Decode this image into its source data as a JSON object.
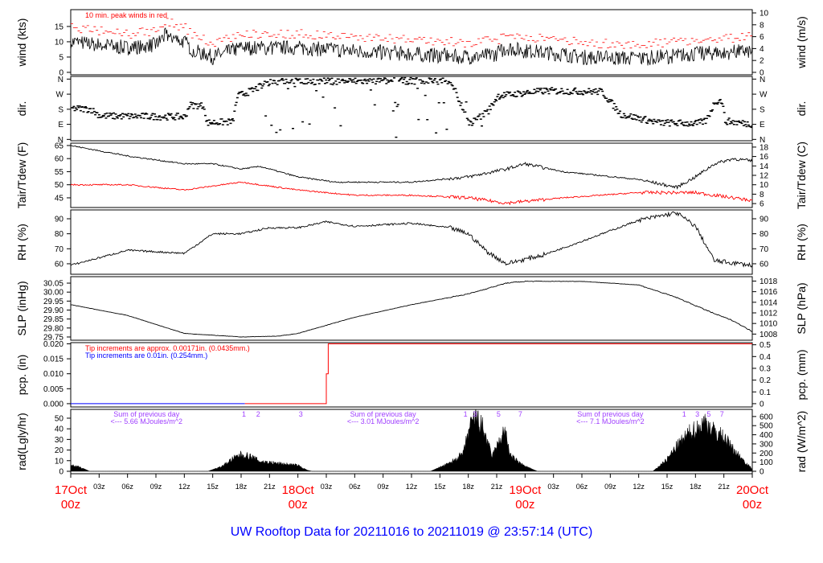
{
  "title": "UW Rooftop Data for 20211016  to  20211019 @ 23:57:14  (UTC)",
  "chart_data": {
    "type": "line",
    "x_unit": "hours since 17Oct 00z",
    "xlim": [
      0,
      72
    ],
    "x_ticks": [
      "03z",
      "06z",
      "09z",
      "12z",
      "15z",
      "18z",
      "21z"
    ],
    "day_labels": [
      {
        "hour": 0,
        "day": "17Oct",
        "time": "00z"
      },
      {
        "hour": 24,
        "day": "18Oct",
        "time": "00z"
      },
      {
        "hour": 48,
        "day": "19Oct",
        "time": "00z"
      },
      {
        "hour": 72,
        "day": "20Oct",
        "time": "00z"
      }
    ],
    "panels": [
      {
        "id": "wind",
        "ylabel": "wind (kts)",
        "ylabel_right": "wind (m/s)",
        "ylim": [
          -0.8,
          20.5
        ],
        "ticks": [
          0,
          5,
          10,
          15
        ],
        "right_ticks": [
          0,
          2,
          4,
          6,
          8,
          10
        ],
        "right_factor": 1.944,
        "annotation": "10 min. peak winds in red",
        "series": [
          {
            "name": "wind",
            "color": "#000000",
            "points": [
              [
                0,
                10
              ],
              [
                3,
                9
              ],
              [
                6,
                8
              ],
              [
                9,
                9
              ],
              [
                10,
                12
              ],
              [
                12,
                10
              ],
              [
                13,
                7
              ],
              [
                15,
                5
              ],
              [
                18,
                8
              ],
              [
                24,
                8
              ],
              [
                30,
                7
              ],
              [
                36,
                6
              ],
              [
                42,
                5
              ],
              [
                45,
                6
              ],
              [
                46,
                8
              ],
              [
                48,
                7
              ],
              [
                52,
                6
              ],
              [
                54,
                5
              ],
              [
                60,
                4.5
              ],
              [
                66,
                6
              ],
              [
                72,
                7
              ]
            ]
          }
        ],
        "peak_offset": 4
      },
      {
        "id": "dir",
        "ylabel": "dir.",
        "ylabel_right": "dir.",
        "ylim": [
          -8,
          376
        ],
        "tick_labels": [
          "N",
          "E",
          "S",
          "W",
          "N"
        ],
        "ticks": [
          0,
          90,
          180,
          270,
          360
        ],
        "series": [
          {
            "name": "direction",
            "color": "#000000",
            "points": [
              [
                0,
                185
              ],
              [
                2,
                180
              ],
              [
                3,
                140
              ],
              [
                12,
                135
              ],
              [
                12.4,
                205
              ],
              [
                14,
                200
              ],
              [
                14.2,
                100
              ],
              [
                17,
                105
              ],
              [
                17.5,
                260
              ],
              [
                19,
                290
              ],
              [
                21,
                345
              ],
              [
                40,
                350
              ],
              [
                42,
                90
              ],
              [
                44,
                170
              ],
              [
                45,
                260
              ],
              [
                50,
                290
              ],
              [
                56,
                285
              ],
              [
                58,
                150
              ],
              [
                62,
                100
              ],
              [
                66,
                95
              ],
              [
                67,
                110
              ],
              [
                68,
                230
              ],
              [
                68.7,
                230
              ],
              [
                69,
                110
              ],
              [
                72,
                90
              ]
            ]
          }
        ]
      },
      {
        "id": "temp",
        "ylabel": "Tair/Tdew (F)",
        "ylabel_right": "Tair/Tdew (C)",
        "ylim": [
          41.3,
          65.9
        ],
        "ticks": [
          45,
          50,
          55,
          60,
          65
        ],
        "right_ticks": [
          6,
          8,
          10,
          12,
          14,
          16,
          18
        ],
        "right_convert": "c2f",
        "series": [
          {
            "name": "Tair",
            "color": "#000000",
            "points": [
              [
                0,
                65
              ],
              [
                6,
                61
              ],
              [
                12,
                58
              ],
              [
                15,
                58
              ],
              [
                18,
                56
              ],
              [
                20,
                57
              ],
              [
                24,
                53
              ],
              [
                28,
                51
              ],
              [
                36,
                51
              ],
              [
                42,
                53
              ],
              [
                46,
                56
              ],
              [
                48,
                58
              ],
              [
                52,
                55
              ],
              [
                60,
                52
              ],
              [
                64,
                49
              ],
              [
                66,
                53
              ],
              [
                68,
                58
              ],
              [
                70,
                60
              ],
              [
                72,
                59
              ]
            ]
          },
          {
            "name": "Tdew",
            "color": "#ff0000",
            "points": [
              [
                0,
                50
              ],
              [
                6,
                50
              ],
              [
                12,
                48
              ],
              [
                18,
                51
              ],
              [
                24,
                48
              ],
              [
                30,
                46
              ],
              [
                36,
                46
              ],
              [
                42,
                45
              ],
              [
                46,
                43
              ],
              [
                52,
                45
              ],
              [
                60,
                47
              ],
              [
                66,
                47
              ],
              [
                68,
                46
              ],
              [
                72,
                44
              ]
            ]
          }
        ]
      },
      {
        "id": "rh",
        "ylabel": "RH (%)",
        "ylabel_right": "RH (%)",
        "ylim": [
          53,
          95.9
        ],
        "ticks": [
          60,
          70,
          80,
          90
        ],
        "right_ticks": [
          60,
          70,
          80,
          90
        ],
        "series": [
          {
            "name": "RH",
            "color": "#000000",
            "points": [
              [
                0,
                59
              ],
              [
                6,
                69
              ],
              [
                12,
                67
              ],
              [
                15,
                80
              ],
              [
                18,
                80
              ],
              [
                21,
                84
              ],
              [
                24,
                84
              ],
              [
                27,
                88
              ],
              [
                30,
                85
              ],
              [
                36,
                87
              ],
              [
                40,
                84
              ],
              [
                42,
                80
              ],
              [
                44,
                68
              ],
              [
                46,
                60
              ],
              [
                50,
                66
              ],
              [
                54,
                75
              ],
              [
                60,
                89
              ],
              [
                64,
                94
              ],
              [
                66,
                85
              ],
              [
                68,
                62
              ],
              [
                72,
                59
              ]
            ]
          }
        ]
      },
      {
        "id": "slp",
        "ylabel": "SLP (inHg)",
        "ylabel_right": "SLP (hPa)",
        "ylim": [
          29.732,
          30.086
        ],
        "ticks": [
          29.75,
          29.8,
          29.85,
          29.9,
          29.95,
          30.0,
          30.05
        ],
        "right_ticks": [
          1008,
          1010,
          1012,
          1014,
          1016,
          1018
        ],
        "right_factor": 33.8639,
        "series": [
          {
            "name": "SLP",
            "color": "#000000",
            "points": [
              [
                0,
                29.93
              ],
              [
                6,
                29.87
              ],
              [
                12,
                29.77
              ],
              [
                18,
                29.75
              ],
              [
                22,
                29.755
              ],
              [
                24,
                29.77
              ],
              [
                30,
                29.86
              ],
              [
                36,
                29.93
              ],
              [
                42,
                29.99
              ],
              [
                46,
                30.05
              ],
              [
                48,
                30.06
              ],
              [
                54,
                30.06
              ],
              [
                60,
                30.04
              ],
              [
                64,
                29.97
              ],
              [
                68,
                29.88
              ],
              [
                70,
                29.84
              ],
              [
                72,
                29.78
              ]
            ]
          }
        ]
      },
      {
        "id": "pcp",
        "ylabel": "pcp. (in)",
        "ylabel_right": "pcp. (mm)",
        "ylim": [
          -0.0011,
          0.0204
        ],
        "ticks": [
          0,
          0.005,
          0.01,
          0.015,
          0.02
        ],
        "tick_format": 3,
        "right_ticks": [
          0,
          0.1,
          0.2,
          0.3,
          0.4,
          0.5
        ],
        "right_factor": 0.03937,
        "notes": [
          {
            "text": "Tip increments are approx. 0.00171in. (0.0435mm.)",
            "color": "#ff0000"
          },
          {
            "text": "Tip increments are 0.01in. (0.254mm.)",
            "color": "#0000ff"
          }
        ],
        "series": [
          {
            "name": "pcp-blue",
            "color": "#0000ff",
            "points": [
              [
                0,
                0
              ],
              [
                18.4,
                0
              ]
            ]
          },
          {
            "name": "pcp-red",
            "color": "#ff0000",
            "points": [
              [
                18.4,
                0
              ],
              [
                27,
                0
              ],
              [
                27,
                0.01
              ],
              [
                27.2,
                0.01
              ],
              [
                27.2,
                0.02
              ],
              [
                72,
                0.02
              ]
            ]
          }
        ]
      },
      {
        "id": "rad",
        "ylabel": "rad(Lgly/hr)",
        "ylabel_right": "rad (W/m^2)",
        "ylim": [
          -2.3,
          58.3
        ],
        "ticks": [
          0,
          10,
          20,
          30,
          40,
          50
        ],
        "right_ticks": [
          0,
          100,
          200,
          300,
          400,
          500,
          600
        ],
        "right_factor": 0.086,
        "sums": [
          {
            "hour": 8,
            "line1": "Sum of previous day",
            "line2": "<--- 5.66 MJoules/m^2"
          },
          {
            "hour": 33,
            "line1": "Sum of previous day",
            "line2": "<--- 3.01 MJoules/m^2"
          },
          {
            "hour": 57,
            "line1": "Sum of previous day",
            "line2": "<--- 7.1 MJoules/m^2"
          }
        ],
        "marks": [
          {
            "hour": 18.3,
            "t": "1"
          },
          {
            "hour": 19.8,
            "t": "2"
          },
          {
            "hour": 24.3,
            "t": "3"
          },
          {
            "hour": 41.7,
            "t": "1"
          },
          {
            "hour": 42.7,
            "t": "3"
          },
          {
            "hour": 45.2,
            "t": "5"
          },
          {
            "hour": 47.5,
            "t": "7"
          },
          {
            "hour": 64.8,
            "t": "1"
          },
          {
            "hour": 66.2,
            "t": "3"
          },
          {
            "hour": 67.4,
            "t": "5"
          },
          {
            "hour": 68.8,
            "t": "7"
          }
        ],
        "series": [
          {
            "name": "radiation",
            "color": "#000000",
            "points": [
              [
                0,
                7
              ],
              [
                1,
                4
              ],
              [
                2,
                0
              ],
              [
                14.5,
                0
              ],
              [
                16,
                5
              ],
              [
                17,
                12
              ],
              [
                18,
                17
              ],
              [
                19,
                15
              ],
              [
                20,
                10
              ],
              [
                22,
                8
              ],
              [
                24,
                6
              ],
              [
                25,
                1
              ],
              [
                25.5,
                0
              ],
              [
                38,
                0
              ],
              [
                40,
                8
              ],
              [
                41.5,
                18
              ],
              [
                42,
                40
              ],
              [
                42.7,
                55
              ],
              [
                43.5,
                45
              ],
              [
                44.5,
                15
              ],
              [
                45.3,
                30
              ],
              [
                45.8,
                42
              ],
              [
                46.5,
                15
              ],
              [
                48,
                5
              ],
              [
                49.3,
                0
              ],
              [
                61.5,
                0
              ],
              [
                63,
                12
              ],
              [
                64,
                25
              ],
              [
                65.5,
                40
              ],
              [
                66.5,
                45
              ],
              [
                67,
                50
              ],
              [
                68,
                40
              ],
              [
                69,
                35
              ],
              [
                70,
                22
              ],
              [
                71,
                12
              ],
              [
                72,
                2
              ]
            ]
          }
        ]
      }
    ]
  }
}
